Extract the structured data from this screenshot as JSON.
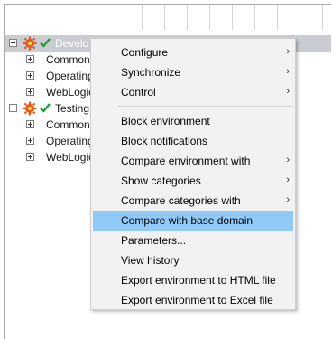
{
  "tree": {
    "rows": [
      {
        "label": "Develo",
        "type": "environment",
        "expanded": true,
        "selected": true
      },
      {
        "label": "Common",
        "type": "category"
      },
      {
        "label": "Operating",
        "type": "category"
      },
      {
        "label": "WebLogic",
        "type": "category"
      },
      {
        "label": "Testing",
        "type": "environment",
        "expanded": true,
        "selected": false
      },
      {
        "label": "Common",
        "type": "category"
      },
      {
        "label": "Operating",
        "type": "category"
      },
      {
        "label": "WebLogic",
        "type": "category"
      }
    ]
  },
  "context_menu": {
    "group1": [
      {
        "label": "Configure",
        "submenu": true
      },
      {
        "label": "Synchronize",
        "submenu": true
      },
      {
        "label": "Control",
        "submenu": true
      }
    ],
    "group2": [
      {
        "label": "Block environment",
        "submenu": false
      },
      {
        "label": "Block notifications",
        "submenu": false
      },
      {
        "label": "Compare environment with",
        "submenu": true
      },
      {
        "label": "Show categories",
        "submenu": true
      },
      {
        "label": "Compare categories with",
        "submenu": true
      },
      {
        "label": "Compare with base domain",
        "submenu": false,
        "highlighted": true
      },
      {
        "label": "Parameters...",
        "submenu": false
      },
      {
        "label": "View history",
        "submenu": false
      },
      {
        "label": "Export environment to HTML file",
        "submenu": false
      },
      {
        "label": "Export environment to Excel file",
        "submenu": false
      }
    ],
    "arrow_glyph": "›"
  },
  "colors": {
    "selection": "#c9ccd1",
    "menu_highlight": "#91c9f7",
    "menu_background": "#f2f2f2",
    "check": "#1f9a2e",
    "gear": "#e8561c"
  },
  "icons": [
    "expand-toggle-icon",
    "collapse-toggle-icon",
    "gear-icon",
    "check-icon",
    "submenu-arrow-icon"
  ]
}
